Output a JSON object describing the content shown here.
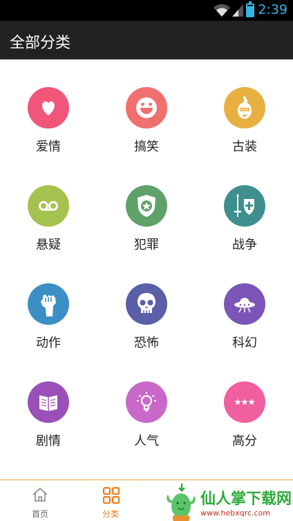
{
  "status_bar": {
    "time": "2:39",
    "accent": "#33b5e5"
  },
  "header": {
    "title": "全部分类"
  },
  "categories": [
    {
      "label": "爱情",
      "icon": "heart-icon",
      "color": "#f0557a"
    },
    {
      "label": "搞笑",
      "icon": "laugh-face-icon",
      "color": "#f07070"
    },
    {
      "label": "古装",
      "icon": "ancient-helmet-icon",
      "color": "#e8b040"
    },
    {
      "label": "悬疑",
      "icon": "voicemail-icon",
      "color": "#a5c24e"
    },
    {
      "label": "犯罪",
      "icon": "police-badge-icon",
      "color": "#5ea26a"
    },
    {
      "label": "战争",
      "icon": "sword-shield-icon",
      "color": "#3e8f8e"
    },
    {
      "label": "动作",
      "icon": "fist-icon",
      "color": "#3b8fc5"
    },
    {
      "label": "恐怖",
      "icon": "skull-icon",
      "color": "#5a5fa8"
    },
    {
      "label": "科幻",
      "icon": "ufo-icon",
      "color": "#7b55b8"
    },
    {
      "label": "剧情",
      "icon": "book-icon",
      "color": "#9a50b8"
    },
    {
      "label": "人气",
      "icon": "lightbulb-icon",
      "color": "#c868c8"
    },
    {
      "label": "高分",
      "icon": "stars-icon",
      "color": "#f060a0"
    }
  ],
  "bottom_nav": {
    "items": [
      {
        "label": "首页",
        "icon": "home-icon"
      },
      {
        "label": "分类",
        "icon": "category-grid-icon",
        "active": true
      }
    ],
    "active_color": "#f07c1d"
  },
  "watermark": {
    "title": "仙人掌下载网",
    "url": "www.hebxqrc.com"
  }
}
